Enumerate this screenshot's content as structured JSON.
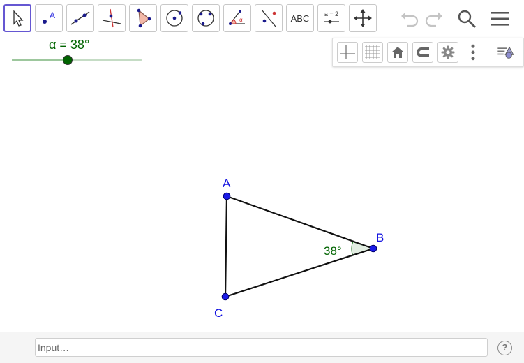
{
  "toolbar": {
    "tools": [
      {
        "name": "move-tool",
        "icon": "arrow-cursor-icon"
      },
      {
        "name": "point-tool",
        "icon": "point-icon",
        "label": "A"
      },
      {
        "name": "line-tool",
        "icon": "line-through-points-icon"
      },
      {
        "name": "perpendicular-line-tool",
        "icon": "perpendicular-line-icon"
      },
      {
        "name": "polygon-tool",
        "icon": "polygon-icon"
      },
      {
        "name": "circle-center-point-tool",
        "icon": "circle-center-icon"
      },
      {
        "name": "circle-three-points-tool",
        "icon": "circle-three-points-icon"
      },
      {
        "name": "angle-tool",
        "icon": "angle-icon"
      },
      {
        "name": "reflect-tool",
        "icon": "reflect-about-line-icon"
      },
      {
        "name": "text-tool",
        "icon": "text-icon",
        "label": "ABC"
      },
      {
        "name": "slider-tool",
        "icon": "slider-icon",
        "label": "a = 2"
      },
      {
        "name": "move-graphics-view-tool",
        "icon": "move-view-icon"
      }
    ],
    "undo_icon": "undo-icon",
    "redo_icon": "redo-icon",
    "search_icon": "search-icon",
    "menu_icon": "hamburger-menu-icon"
  },
  "stylebar": {
    "buttons": [
      "axes-icon",
      "grid-icon",
      "home-icon",
      "point-capture-icon",
      "gear-icon",
      "more-vertical-icon",
      "view-toggle-icon"
    ]
  },
  "slider": {
    "label": "α = 38°",
    "value": 38,
    "fraction": 0.43
  },
  "construction": {
    "points": [
      {
        "name": "A",
        "label": "A"
      },
      {
        "name": "B",
        "label": "B"
      },
      {
        "name": "C",
        "label": "C"
      }
    ],
    "angle_label": "38°"
  },
  "colors": {
    "accent": "#6557d2",
    "point": "#1010e0",
    "slider": "#006400",
    "angle_fill": "#cfe3cf"
  },
  "input": {
    "placeholder": "Input…",
    "help": "?"
  }
}
